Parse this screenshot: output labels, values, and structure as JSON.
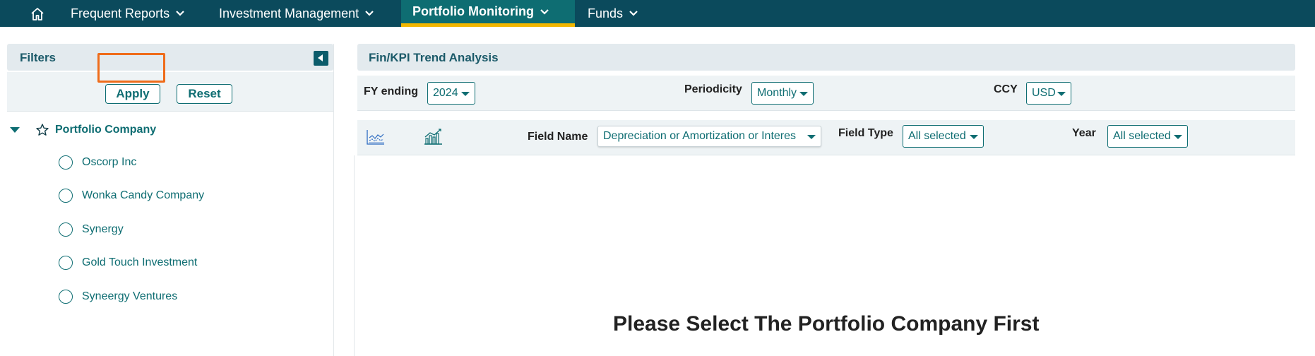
{
  "nav": {
    "items": [
      {
        "label": "Frequent Reports"
      },
      {
        "label": "Investment Management"
      },
      {
        "label": "Portfolio Monitoring",
        "active": true
      },
      {
        "label": "Funds"
      }
    ],
    "home_icon": "home-icon",
    "chevron_icon": "chevron-down-icon"
  },
  "filters": {
    "title": "Filters",
    "apply_label": "Apply",
    "reset_label": "Reset",
    "tree": {
      "root_label": "Portfolio Company",
      "items": [
        {
          "label": "Oscorp Inc"
        },
        {
          "label": "Wonka Candy Company"
        },
        {
          "label": "Synergy"
        },
        {
          "label": "Gold Touch Investment"
        },
        {
          "label": "Syneergy Ventures"
        }
      ]
    }
  },
  "analysis": {
    "title": "Fin/KPI Trend Analysis",
    "fy_label": "FY ending",
    "fy_value": "2024",
    "periodicity_label": "Periodicity",
    "periodicity_value": "Monthly",
    "ccy_label": "CCY",
    "ccy_value": "USD",
    "field_name_label": "Field Name",
    "field_name_value": "Depreciation or Amortization or Interes",
    "field_type_label": "Field Type",
    "field_type_value": "All selected",
    "year_label": "Year",
    "year_value": "All selected",
    "empty_message": "Please Select The Portfolio Company First"
  },
  "colors": {
    "nav_bg": "#0b4a5c",
    "active_tab_bg": "#0e6d72",
    "active_underline": "#f2b600",
    "accent": "#0e6d72",
    "focus_outline": "#ef6c1a"
  }
}
